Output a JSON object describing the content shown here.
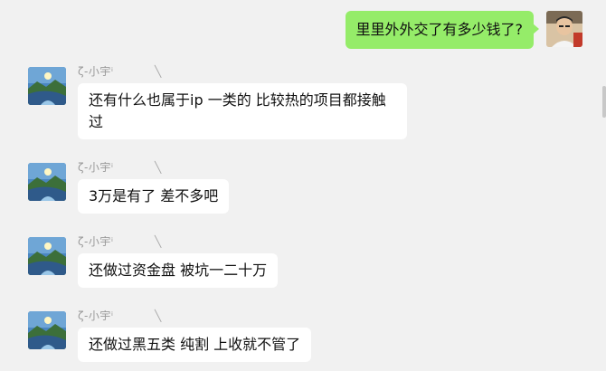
{
  "outgoing": {
    "text": "里里外外交了有多少钱了?"
  },
  "incoming": [
    {
      "sender": "ζ-小宇ⁱ",
      "mark": "╲",
      "text": "还有什么也属于ip 一类的 比较热的项目都接触过"
    },
    {
      "sender": "ζ-小宇ⁱ",
      "mark": "╲",
      "text": "3万是有了 差不多吧"
    },
    {
      "sender": "ζ-小宇ⁱ",
      "mark": "╲",
      "text": "还做过资金盘 被坑一二十万"
    },
    {
      "sender": "ζ-小宇ⁱ",
      "mark": "╲",
      "text": "还做过黑五类 纯割 上收就不管了"
    }
  ],
  "colors": {
    "outgoing_bubble": "#95ec69",
    "incoming_bubble": "#ffffff",
    "background": "#f1f1f1"
  }
}
